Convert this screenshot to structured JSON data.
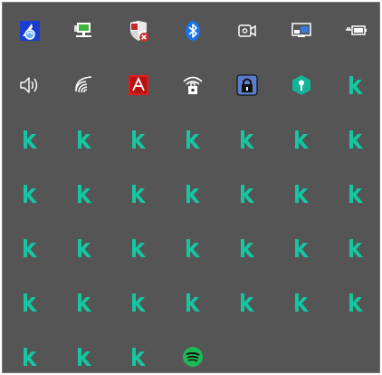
{
  "tray": {
    "title": "",
    "rows": [
      [
        "app-blue-icon",
        "network-monitor-icon",
        "shield-x-icon",
        "bluetooth-icon",
        "camera-icon",
        "display-switch-icon",
        "battery-plug-icon"
      ],
      [
        "speaker-icon",
        "wifi-icon",
        "adobe-icon",
        "wifi-lock-icon",
        "lock-icon",
        "hex-key-icon",
        "k-icon"
      ],
      [
        "k-icon",
        "k-icon",
        "k-icon",
        "k-icon",
        "k-icon",
        "k-icon",
        "k-icon"
      ],
      [
        "k-icon",
        "k-icon",
        "k-icon",
        "k-icon",
        "k-icon",
        "k-icon",
        "k-icon"
      ],
      [
        "k-icon",
        "k-icon",
        "k-icon",
        "k-icon",
        "k-icon",
        "k-icon",
        "k-icon"
      ],
      [
        "k-icon",
        "k-icon",
        "k-icon",
        "k-icon",
        "k-icon",
        "k-icon",
        "k-icon"
      ],
      [
        "k-icon",
        "k-icon",
        "k-icon",
        "spotify-icon"
      ]
    ]
  },
  "colors": {
    "background": "#555555",
    "kaspersky_green": "#14c7a3",
    "spotify_green": "#1db954",
    "bluetooth_blue": "#1a73e8",
    "adobe_red": "#e21b1b",
    "lock_blue": "#5a7ec9",
    "hex_teal": "#14b39a"
  }
}
